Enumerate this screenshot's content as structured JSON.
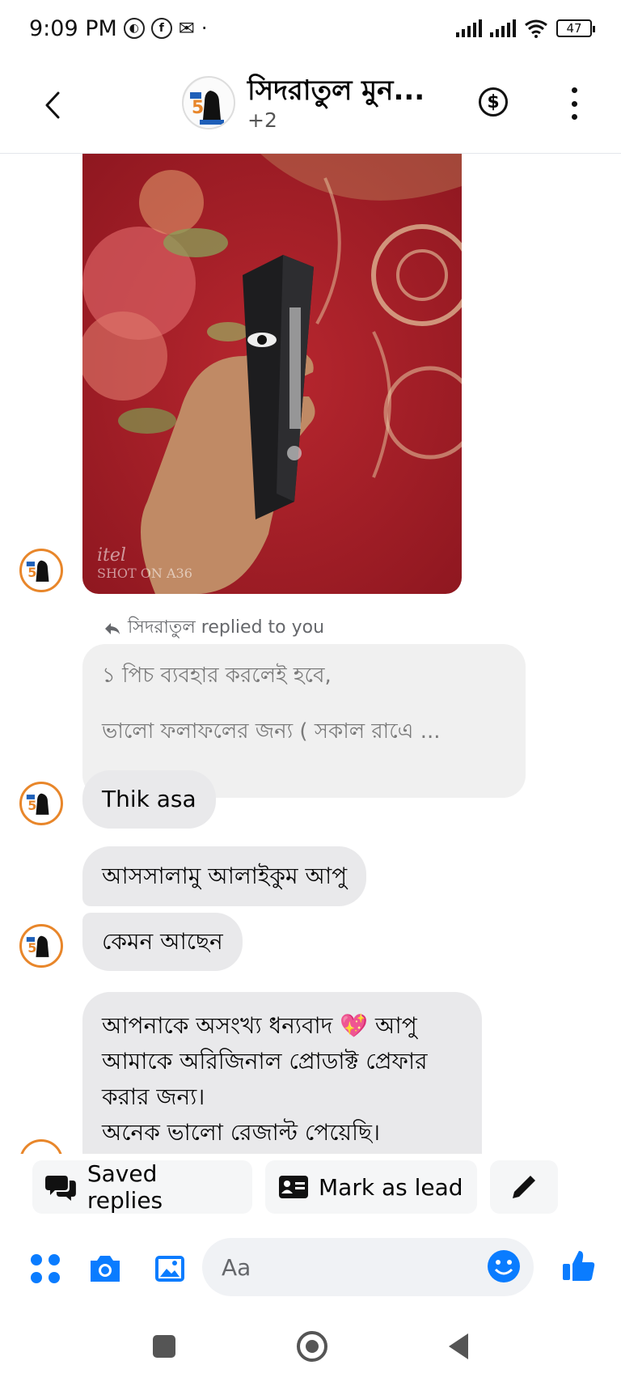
{
  "status_bar": {
    "time": "9:09 PM",
    "battery": "47"
  },
  "header": {
    "title": "সিদরাতুল মুন...",
    "subtitle": "+2",
    "back_icon": "chevron-left-icon",
    "payment_icon": "dollar-circle-icon",
    "more_icon": "vertical-dots-icon"
  },
  "messages": {
    "photo": {
      "watermark_brand": "itel",
      "watermark_shot": "SHOT ON A36"
    },
    "reply_label": "সিদরাতুল replied to you",
    "quoted_line1": "১ পিচ ব্যবহার করলেই হবে,",
    "quoted_line2": "ভালো ফলাফলের জন্য  ( সকাল রাএে ...",
    "msg1": "Thik asa",
    "msg2": "আসসালামু আলাইকুম আপু",
    "msg3": "কেমন আছেন",
    "msg4_line1": "আপনাকে অসংখ্য ধন্যবাদ 💖 আপু",
    "msg4_line2": "আমাকে অরিজিনাল প্রোডাক্ট প্রেফার",
    "msg4_line3": "করার জন্য।",
    "msg4_line4": "অনেক ভালো রেজাল্ট পেয়েছি।",
    "msg4_hearts": "💖💖💖💖💖"
  },
  "quick_actions": {
    "saved_replies": "Saved replies",
    "mark_as_lead": "Mark as lead"
  },
  "composer": {
    "placeholder": "Aa"
  },
  "colors": {
    "accent": "#0a7cff",
    "bubble": "#e9e9eb",
    "avatar_ring": "#e8862a"
  }
}
